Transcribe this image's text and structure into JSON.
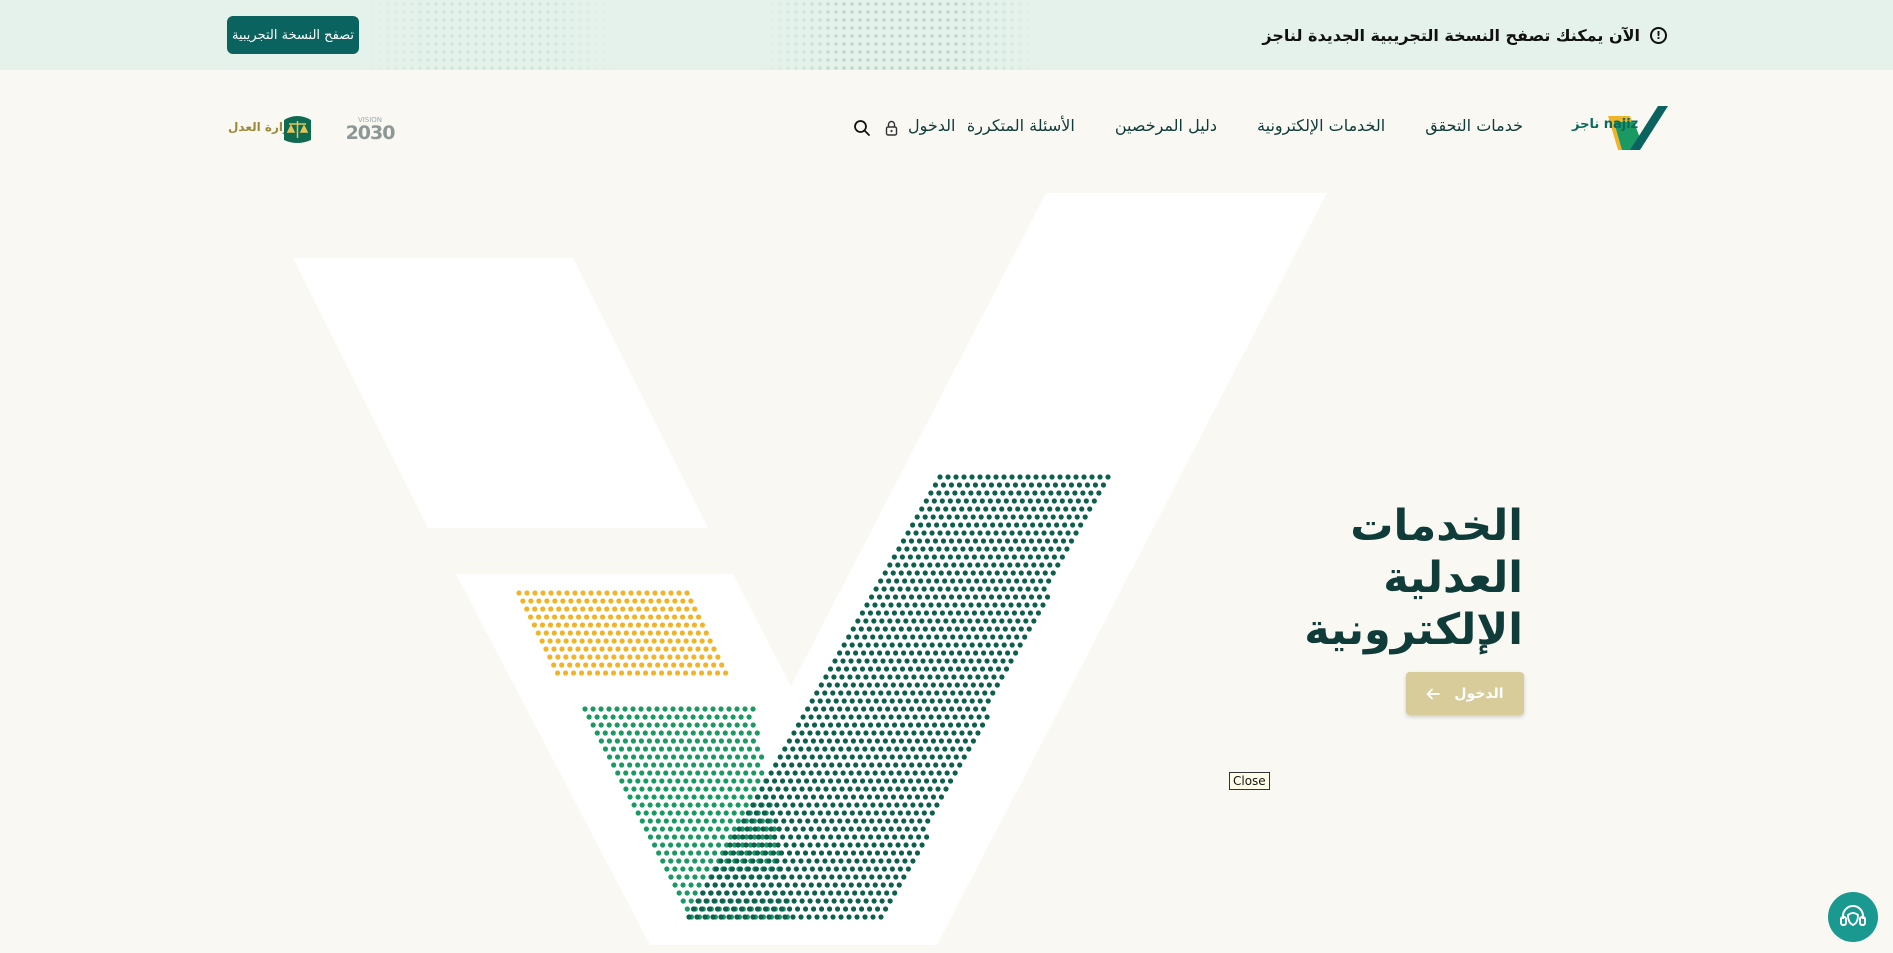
{
  "banner": {
    "message": "الآن يمكنك تصفح النسخة التجريبية الجديدة لناجز",
    "info_icon": "info-icon",
    "trial_button": "تصفح النسخة التجريبية"
  },
  "header": {
    "logo_text": "ناجز najiz",
    "nav_items": [
      "خدمات التحقق",
      "الخدمات الإلكترونية",
      "دليل المرخصين",
      "الأسئلة المتكررة"
    ],
    "login_label": "الدخول",
    "lock_icon": "lock-icon",
    "search_icon": "search-icon",
    "vision_label": "VISION",
    "vision_year": "2030",
    "ministry_label": "وزارة العدل"
  },
  "hero": {
    "title_lines": [
      "الخدمات",
      "العدلية",
      "الإلكترونية"
    ],
    "login_button": "الدخول",
    "arrow_icon": "arrow-left-icon"
  },
  "tooltip": {
    "close": "Close"
  },
  "support": {
    "icon": "headset-icon"
  },
  "colors": {
    "primary": "#0b6360",
    "accent_gold": "#d7cc9a",
    "background": "#f9f8f3",
    "banner_bg": "#e4f2eb",
    "dots_green_dark": "#0f5f4f",
    "dots_green": "#1a9a62",
    "dots_yellow": "#f0b32a"
  }
}
